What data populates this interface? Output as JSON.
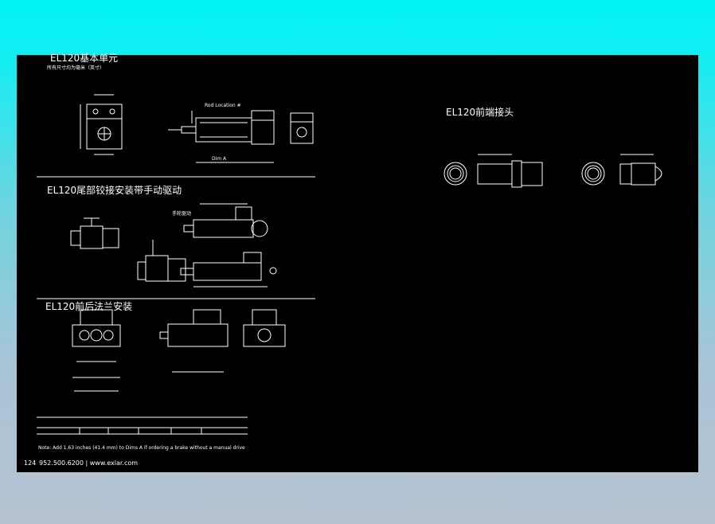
{
  "sections": {
    "basic_unit": {
      "title": "EL120基本单元",
      "subtitle": "所有尺寸均为毫米（英寸）"
    },
    "rear_clevis": {
      "title": "EL120尾部铰接安装带手动驱动",
      "manual_drive_label": "手轮驱动"
    },
    "flange": {
      "title": "EL120前后法兰安装"
    },
    "rod_end": {
      "title": "EL120前端接头"
    }
  },
  "labels": {
    "dim_a": "Dim A",
    "rod_location": "Rod Location #"
  },
  "note": "Note: Add 1.63 inches (41.4 mm) to Dims A if ordering a brake without a manual drive",
  "footer": {
    "page": "124",
    "contact": "952.500.6200 | www.exlar.com"
  }
}
